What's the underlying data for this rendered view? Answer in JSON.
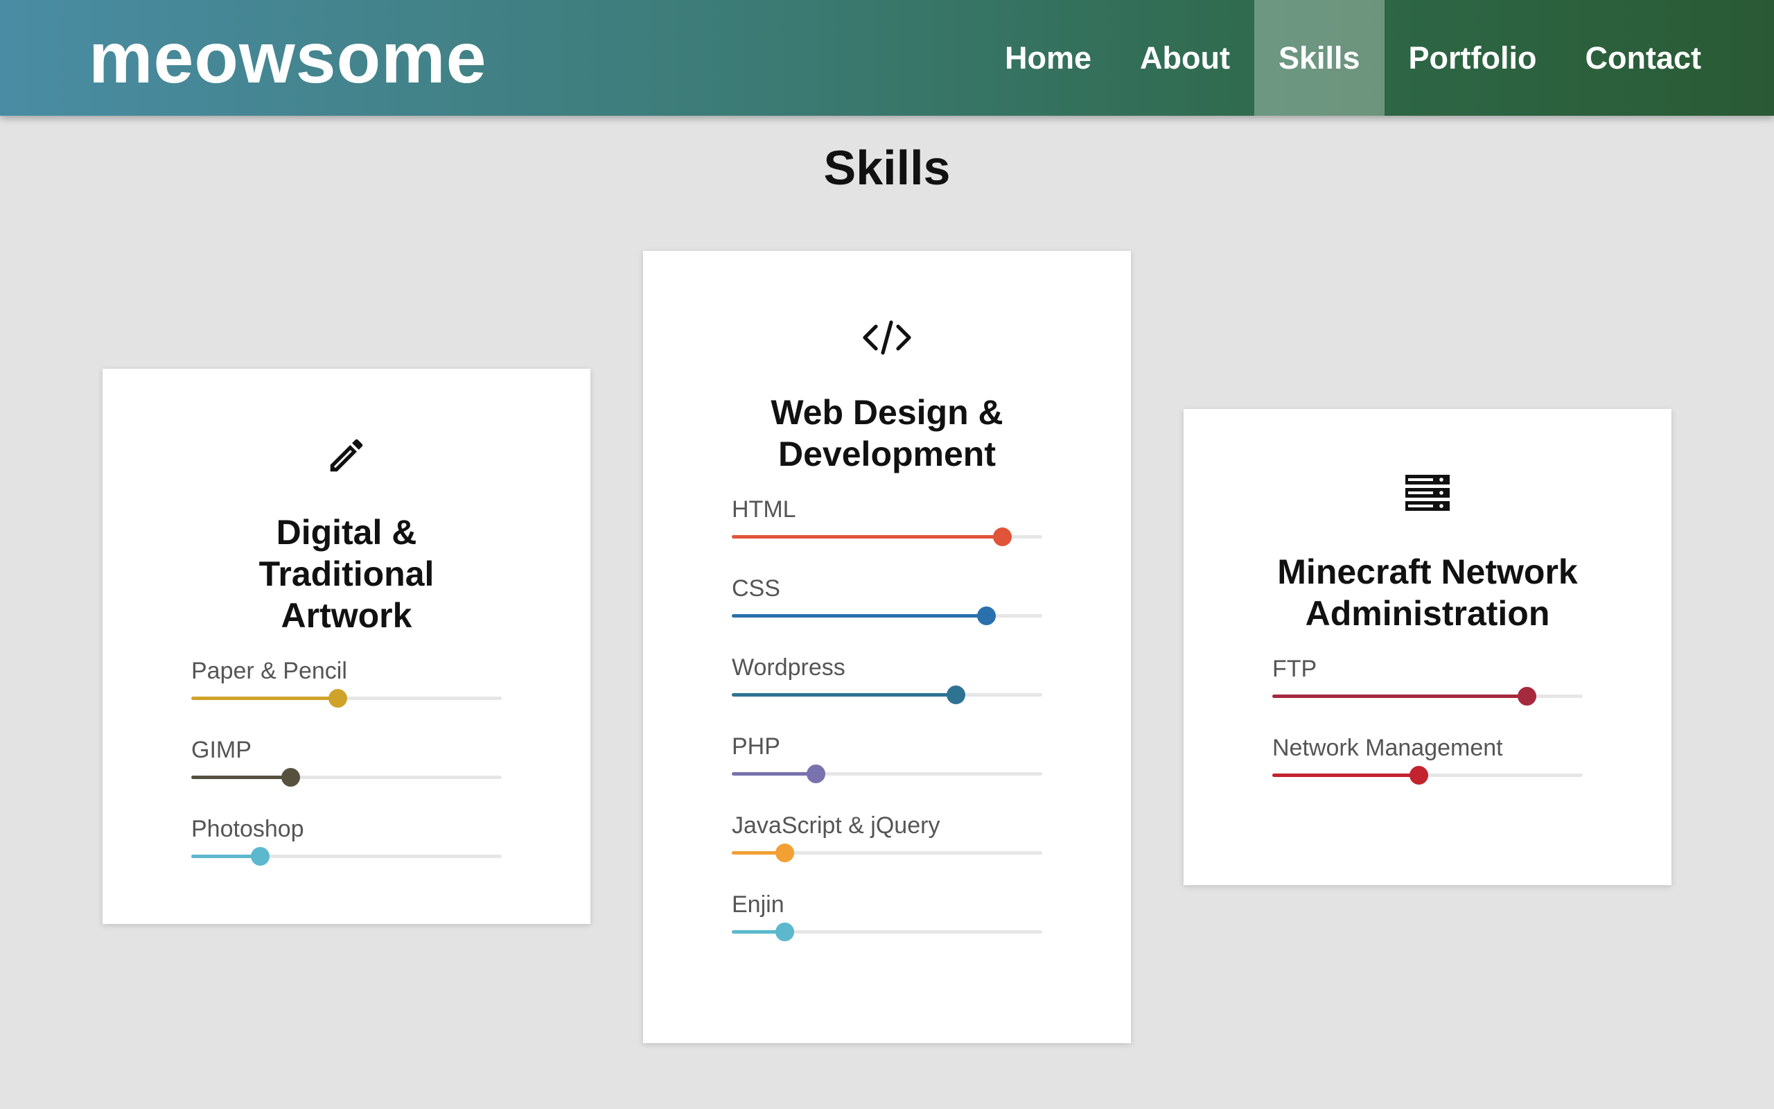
{
  "brand": "meowsome",
  "nav": {
    "home": "Home",
    "about": "About",
    "skills": "Skills",
    "portfolio": "Portfolio",
    "contact": "Contact"
  },
  "page_title": "Skills",
  "cards": [
    {
      "icon": "pencil-icon",
      "title_line1": "Digital &",
      "title_line2": "Traditional Artwork",
      "skills": [
        {
          "label": "Paper & Pencil",
          "level": 0.47,
          "color": "#cfa32a"
        },
        {
          "label": "GIMP",
          "level": 0.32,
          "color": "#56513f"
        },
        {
          "label": "Photoshop",
          "level": 0.22,
          "color": "#5bb8cd"
        }
      ]
    },
    {
      "icon": "code-icon",
      "title_line1": "Web Design &",
      "title_line2": "Development",
      "skills": [
        {
          "label": "HTML",
          "level": 0.87,
          "color": "#e0543a"
        },
        {
          "label": "CSS",
          "level": 0.82,
          "color": "#2a70ad"
        },
        {
          "label": "Wordpress",
          "level": 0.72,
          "color": "#2f7393"
        },
        {
          "label": "PHP",
          "level": 0.27,
          "color": "#7872ad"
        },
        {
          "label": "JavaScript & jQuery",
          "level": 0.17,
          "color": "#f2a033"
        },
        {
          "label": "Enjin",
          "level": 0.17,
          "color": "#5bb8cd"
        }
      ]
    },
    {
      "icon": "server-icon",
      "title_line1": "Minecraft Network",
      "title_line2": "Administration",
      "skills": [
        {
          "label": "FTP",
          "level": 0.82,
          "color": "#a62a3e"
        },
        {
          "label": "Network Management",
          "level": 0.47,
          "color": "#c2232f"
        }
      ]
    }
  ]
}
